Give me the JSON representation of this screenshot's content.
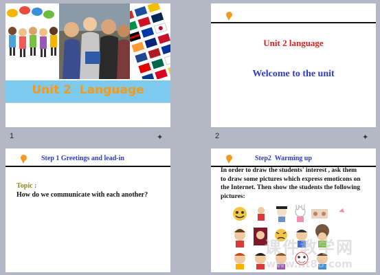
{
  "slides": [
    {
      "number": "1",
      "title": "Unit 2  Language"
    },
    {
      "number": "2",
      "title": "Unit 2 language",
      "subtitle": "Welcome to the unit"
    },
    {
      "number": "",
      "heading": "Step 1 Greetings and lead-in",
      "topic_label": "Topic :",
      "question": "How do we communicate with each another?"
    },
    {
      "number": "",
      "heading": "Step2  Warming up",
      "body": "In order to draw the students' interest , ask them to draw some pictures which express emoticons on the Internet. Then show the students the following pictures:"
    }
  ],
  "slide_icon": "star-icon",
  "watermark": {
    "line1": "课件教学网",
    "line2": "www.ht88.com"
  },
  "colors": {
    "accent_blue": "#7ccbee",
    "title_orange": "#f39a1e",
    "title_red": "#e02020",
    "heading_blue": "#2d3ccc",
    "topic_olive": "#8a8a12"
  }
}
